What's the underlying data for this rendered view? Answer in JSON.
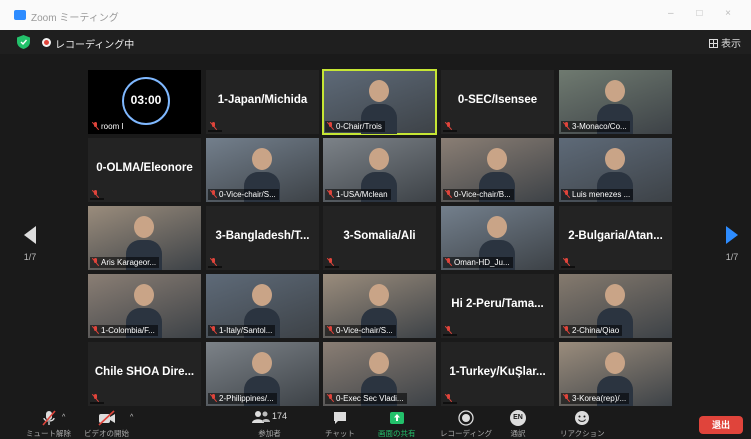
{
  "window": {
    "title": "Zoom ミーティング"
  },
  "topbar": {
    "recording_label": "レコーディング中",
    "view_label": "表示"
  },
  "pagination": {
    "left": "1/7",
    "right": "1/7"
  },
  "timer": "03:00",
  "tiles": [
    {
      "label": "room I",
      "big": "",
      "video": false,
      "black": true
    },
    {
      "label": "",
      "big": "1-Japan/Michida",
      "video": false
    },
    {
      "label": "0-Chair/Trois",
      "big": "",
      "video": true,
      "active": true
    },
    {
      "label": "",
      "big": "0-SEC/Isensee",
      "video": false
    },
    {
      "label": "3-Monaco/Co...",
      "big": "",
      "video": true
    },
    {
      "label": "",
      "big": "0-OLMA/Eleonore",
      "video": false
    },
    {
      "label": "0-Vice-chair/S...",
      "big": "",
      "video": true
    },
    {
      "label": "1-USA/Mclean",
      "big": "",
      "video": true
    },
    {
      "label": "0-Vice-chair/B...",
      "big": "",
      "video": true
    },
    {
      "label": "Luis menezes ...",
      "big": "",
      "video": true
    },
    {
      "label": "Aris Karageor...",
      "big": "",
      "video": true
    },
    {
      "label": "",
      "big": "3-Bangladesh/T...",
      "video": false
    },
    {
      "label": "",
      "big": "3-Somalia/Ali",
      "video": false
    },
    {
      "label": "Oman-HD_Ju...",
      "big": "",
      "video": true
    },
    {
      "label": "",
      "big": "2-Bulgaria/Atan...",
      "video": false
    },
    {
      "label": "1-Colombia/F...",
      "big": "",
      "video": true
    },
    {
      "label": "1-Italy/Santol...",
      "big": "",
      "video": true
    },
    {
      "label": "0-Vice-chair/S...",
      "big": "",
      "video": true
    },
    {
      "label": "",
      "big": "Hi 2-Peru/Tama...",
      "video": false
    },
    {
      "label": "2-China/Qiao",
      "big": "",
      "video": true
    },
    {
      "label": "",
      "big": "Chile SHOA Dire...",
      "video": false
    },
    {
      "label": "2-Philippines/...",
      "big": "",
      "video": true
    },
    {
      "label": "0-Exec Sec Vladi...",
      "big": "",
      "video": true
    },
    {
      "label": "",
      "big": "1-Turkey/KuŞlar...",
      "video": false
    },
    {
      "label": "3-Korea(rep)/...",
      "big": "",
      "video": true
    }
  ],
  "toolbar": {
    "mute": "ミュート解除",
    "video": "ビデオの開始",
    "participants": "参加者",
    "participants_count": "174",
    "chat": "チャット",
    "share": "画面の共有",
    "record": "レコーディング",
    "translate": "通訳",
    "translate_badge": "EN",
    "reactions": "リアクション",
    "leave": "退出"
  },
  "colors": {
    "accent": "#2d8cff",
    "leave": "#e0443b",
    "active_speaker": "#c6e634"
  }
}
